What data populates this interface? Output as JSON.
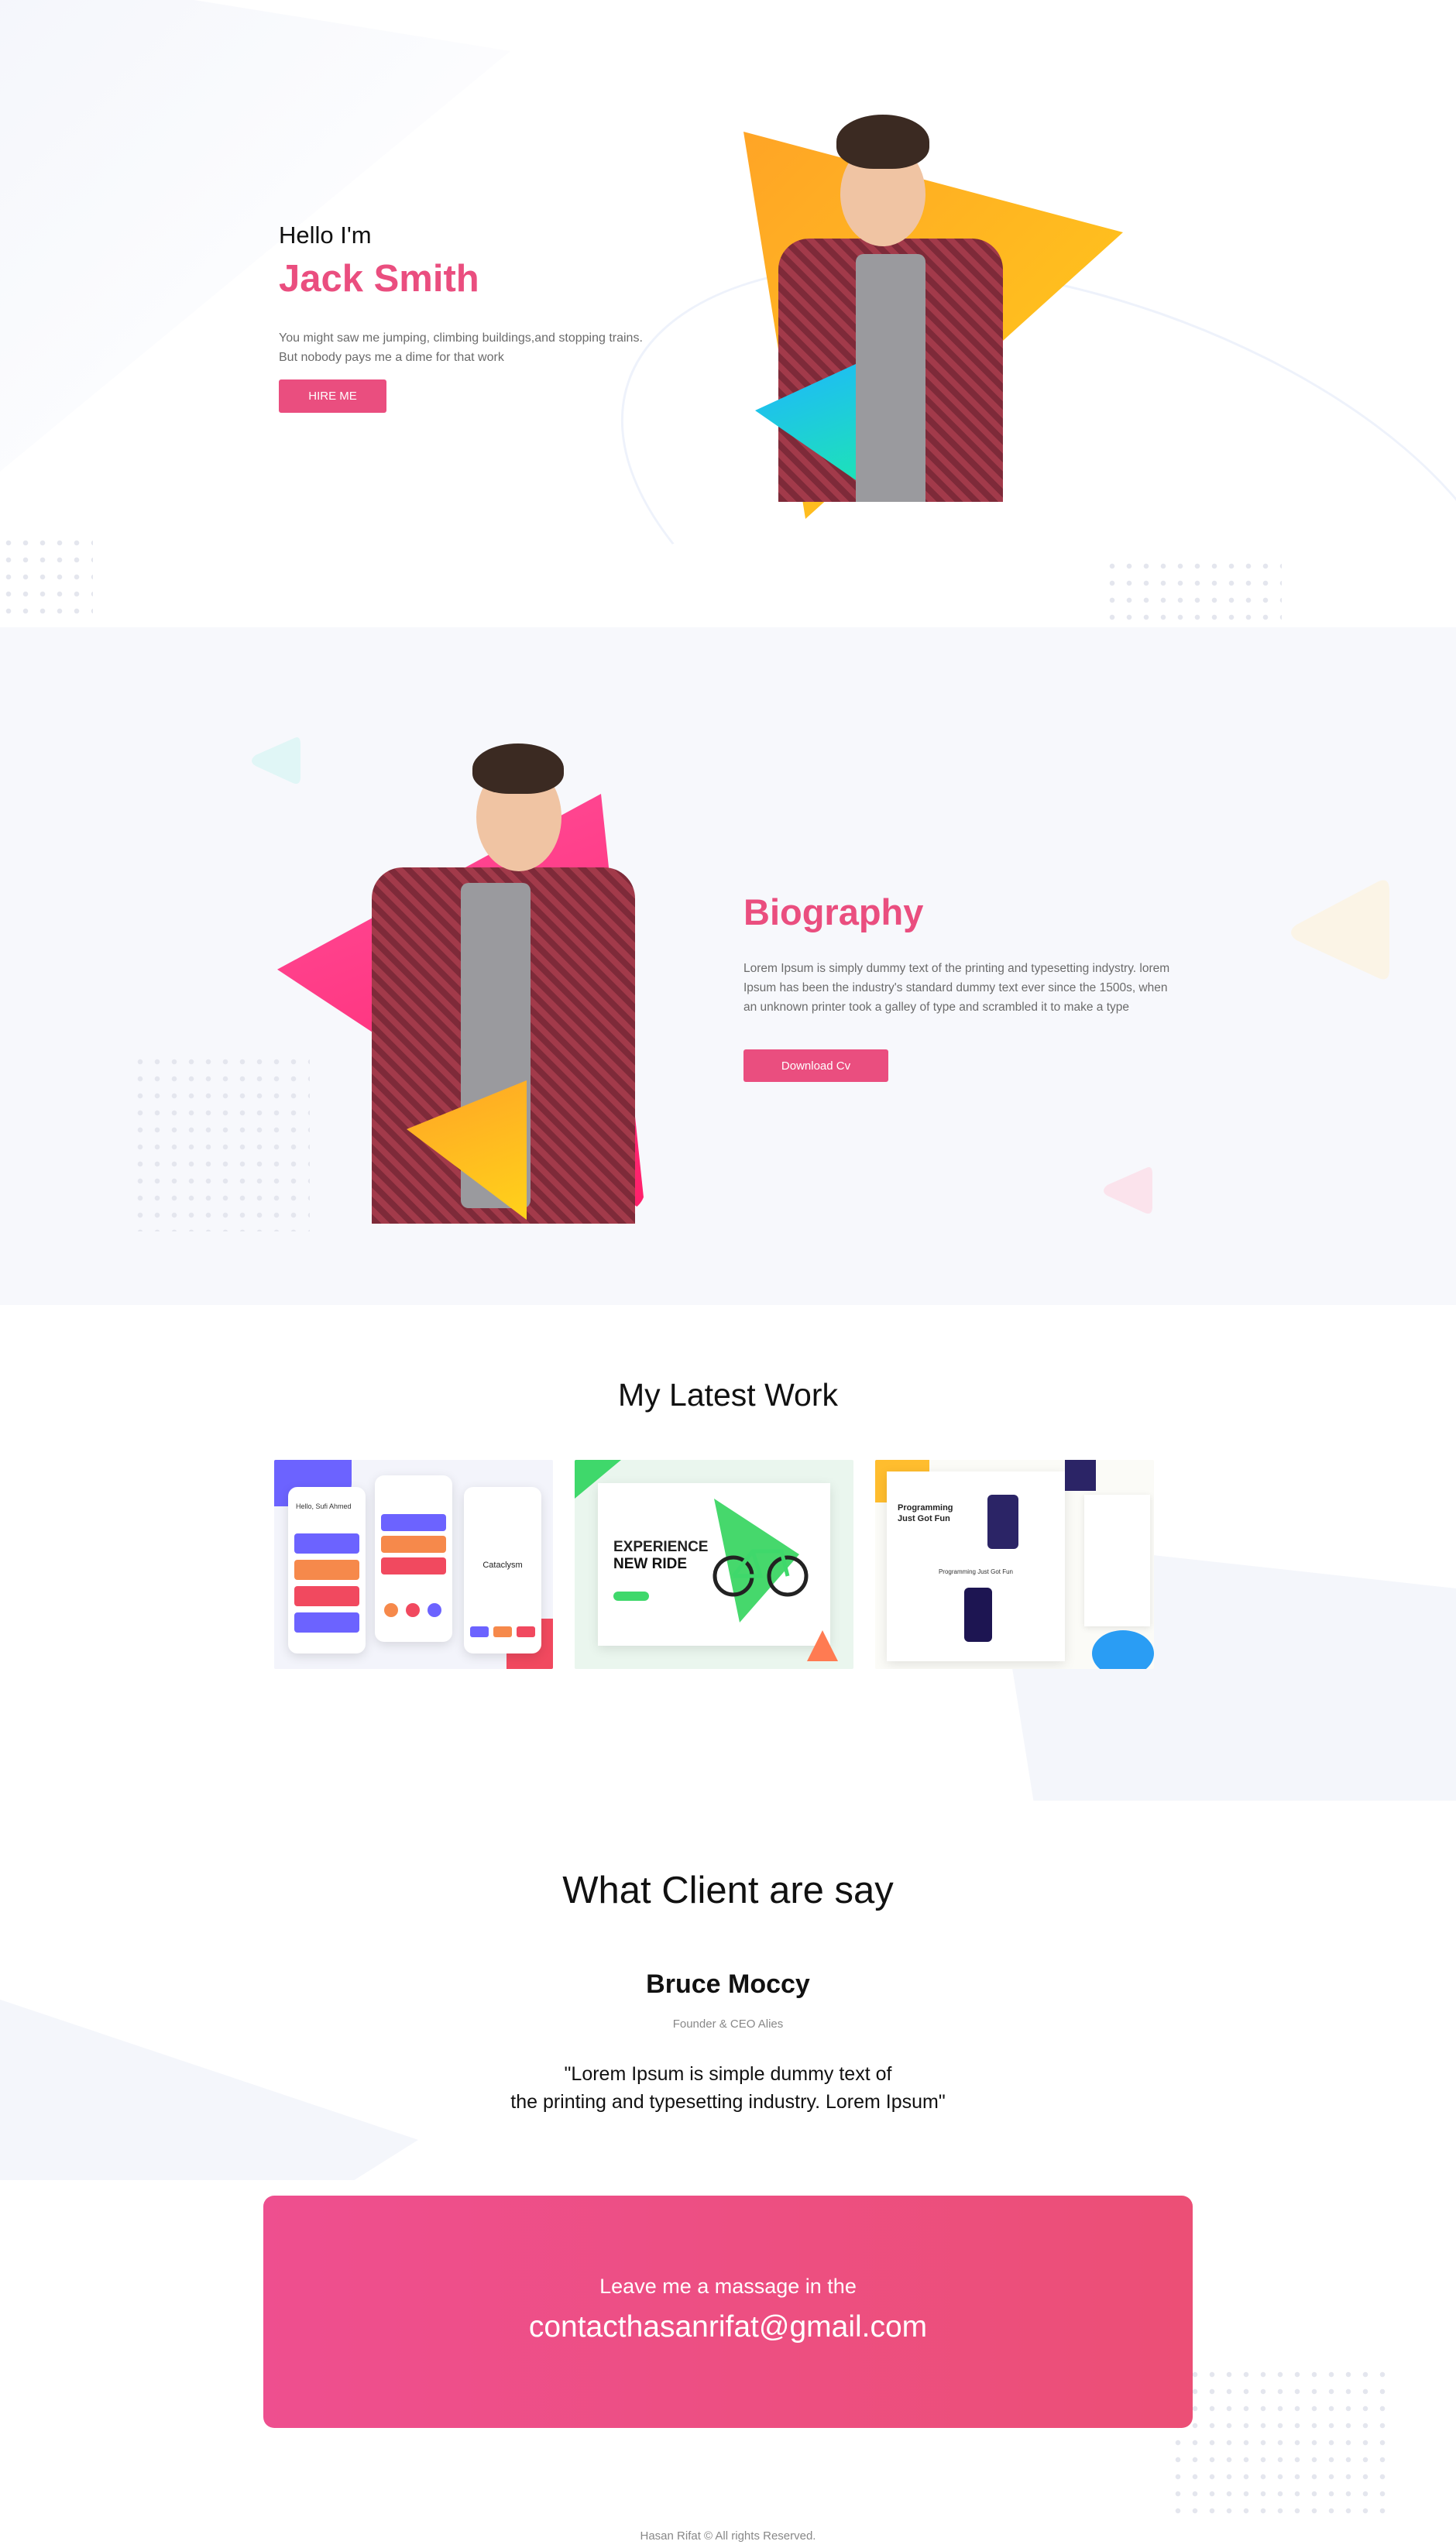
{
  "hero": {
    "greeting": "Hello I'm",
    "name": "Jack Smith",
    "intro_line1": "You might saw me jumping, climbing buildings,and stopping trains.",
    "intro_line2": "But nobody pays me a dime for that work",
    "hire_label": "HIRE ME"
  },
  "biography": {
    "title": "Biography",
    "text": "Lorem Ipsum is simply dummy text of the printing and typesetting indystry. lorem Ipsum has been the industry's standard dummy text ever since the 1500s, when an unknown printer took a galley of type and scrambled it to make a type",
    "button_label": "Download Cv"
  },
  "work": {
    "title": "My Latest Work",
    "items": [
      {
        "name": "Mobile app UI",
        "screen_label": "Cataclysm",
        "greeting": "Hello, Sufi Ahmed"
      },
      {
        "name": "Bike landing page",
        "headline1": "EXPERIENCE",
        "headline2": "NEW RIDE"
      },
      {
        "name": "Programming website",
        "headline1": "Programming",
        "headline2": "Just Got Fun",
        "sub": "Programming Just Got Fun"
      }
    ]
  },
  "clients": {
    "title": "What Client are say",
    "name": "Bruce Moccy",
    "role": "Founder & CEO Alies",
    "quote_line1": "\"Lorem Ipsum is simple dummy text of",
    "quote_line2": "the printing and typesetting industry. Lorem Ipsum\""
  },
  "contact": {
    "label": "Leave me a massage in the",
    "email": "contacthasanrifat@gmail.com"
  },
  "footer": {
    "text": "Hasan Rifat © All rights Reserved."
  },
  "colors": {
    "accent": "#ea4e7f",
    "orange": "#ffa426",
    "yellow": "#ffcd1a",
    "teal": "#1de2b8",
    "bio_bg": "#f7f8fc"
  }
}
